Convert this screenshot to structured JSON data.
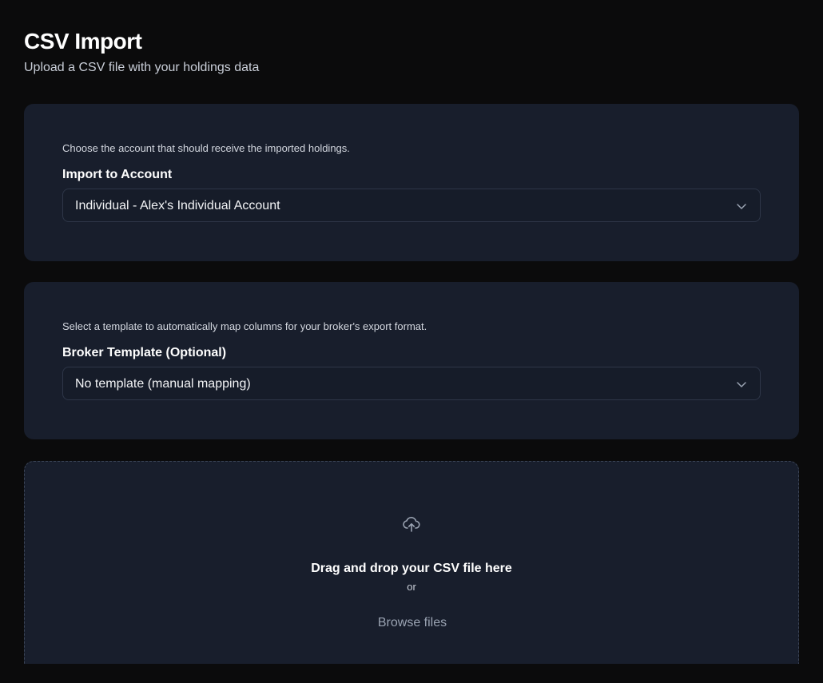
{
  "header": {
    "title": "CSV Import",
    "subtitle": "Upload a CSV file with your holdings data"
  },
  "account_section": {
    "description": "Choose the account that should receive the imported holdings.",
    "label": "Import to Account",
    "selected_value": "Individual - Alex's Individual Account"
  },
  "template_section": {
    "description": "Select a template to automatically map columns for your broker's export format.",
    "label": "Broker Template (Optional)",
    "selected_value": "No template (manual mapping)"
  },
  "dropzone": {
    "icon": "upload-cloud-icon",
    "title": "Drag and drop your CSV file here",
    "or_text": "or",
    "browse_label": "Browse files"
  },
  "colors": {
    "background": "#0b0b0c",
    "card": "#181e2c",
    "border": "#2e3648",
    "muted_text": "#9aa3b2"
  }
}
